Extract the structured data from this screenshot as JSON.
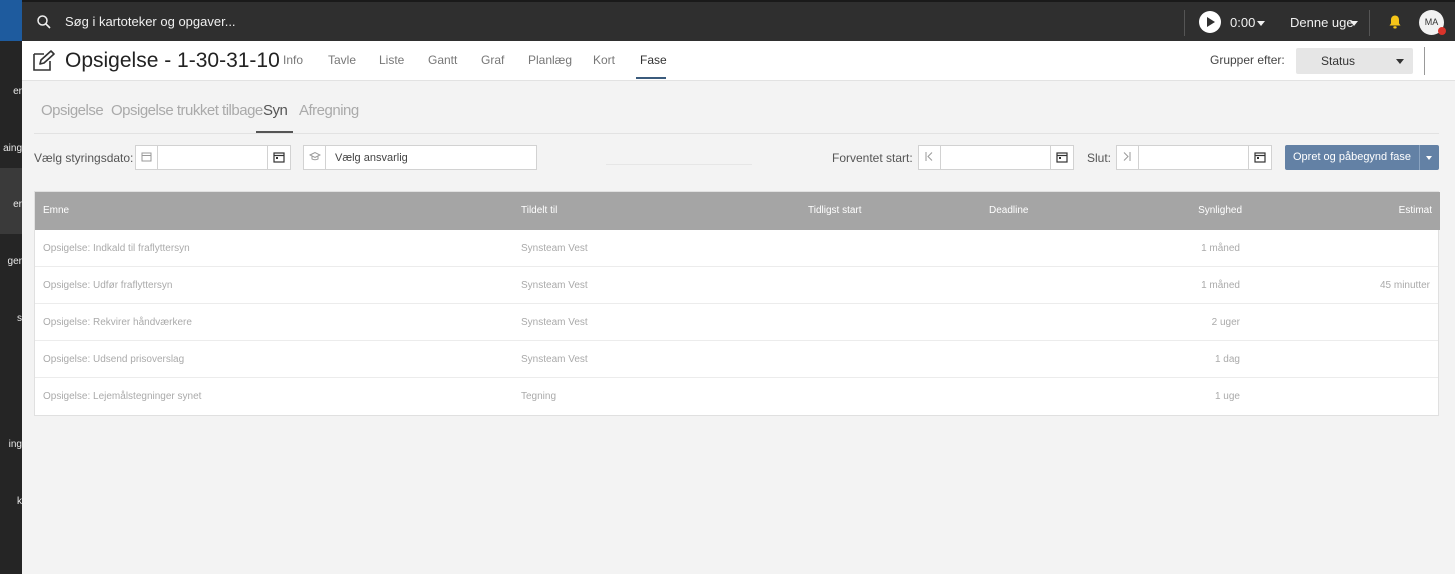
{
  "sidebar": {
    "fragments": [
      "er",
      "aing",
      "er",
      "ger",
      "s",
      "ing",
      "k"
    ]
  },
  "topbar": {
    "search_placeholder": "Søg i kartoteker og opgaver...",
    "timer": "0:00",
    "week": "Denne uge",
    "avatar": "MA"
  },
  "header": {
    "title": "Opsigelse - 1-30-31-10",
    "tabs": [
      "Info",
      "Tavle",
      "Liste",
      "Gantt",
      "Graf",
      "Planlæg",
      "Kort",
      "Fase"
    ],
    "group_label": "Grupper efter:",
    "group_value": "Status"
  },
  "subtabs": [
    "Opsigelse",
    "Opsigelse trukket tilbage",
    "Syn",
    "Afregning"
  ],
  "filters": {
    "styringsdato_label": "Vælg styringsdato:",
    "ansvarlig_placeholder": "Vælg ansvarlig",
    "forventet_start_label": "Forventet start:",
    "slut_label": "Slut:",
    "create_button": "Opret og påbegynd fase"
  },
  "table": {
    "headers": [
      "Emne",
      "Tildelt til",
      "Tidligst start",
      "Deadline",
      "Synlighed",
      "Estimat"
    ],
    "rows": [
      {
        "emne": "Opsigelse: Indkald til fraflyttersyn",
        "tildelt": "Synsteam Vest",
        "synlighed": "1 måned",
        "estimat": ""
      },
      {
        "emne": "Opsigelse: Udfør fraflyttersyn",
        "tildelt": "Synsteam Vest",
        "synlighed": "1 måned",
        "estimat": "45 minutter"
      },
      {
        "emne": "Opsigelse: Rekvirer håndværkere",
        "tildelt": "Synsteam Vest",
        "synlighed": "2 uger",
        "estimat": ""
      },
      {
        "emne": "Opsigelse: Udsend prisoverslag",
        "tildelt": "Synsteam Vest",
        "synlighed": "1 dag",
        "estimat": ""
      },
      {
        "emne": "Opsigelse: Lejemålstegninger synet",
        "tildelt": "Tegning",
        "synlighed": "1 uge",
        "estimat": ""
      }
    ]
  },
  "colors": {
    "topbar": "#2f2f2f",
    "accent": "#6381a5",
    "table_header": "#a5a5a5",
    "notification_dot": "#d9342b",
    "bell": "#f5c518"
  }
}
